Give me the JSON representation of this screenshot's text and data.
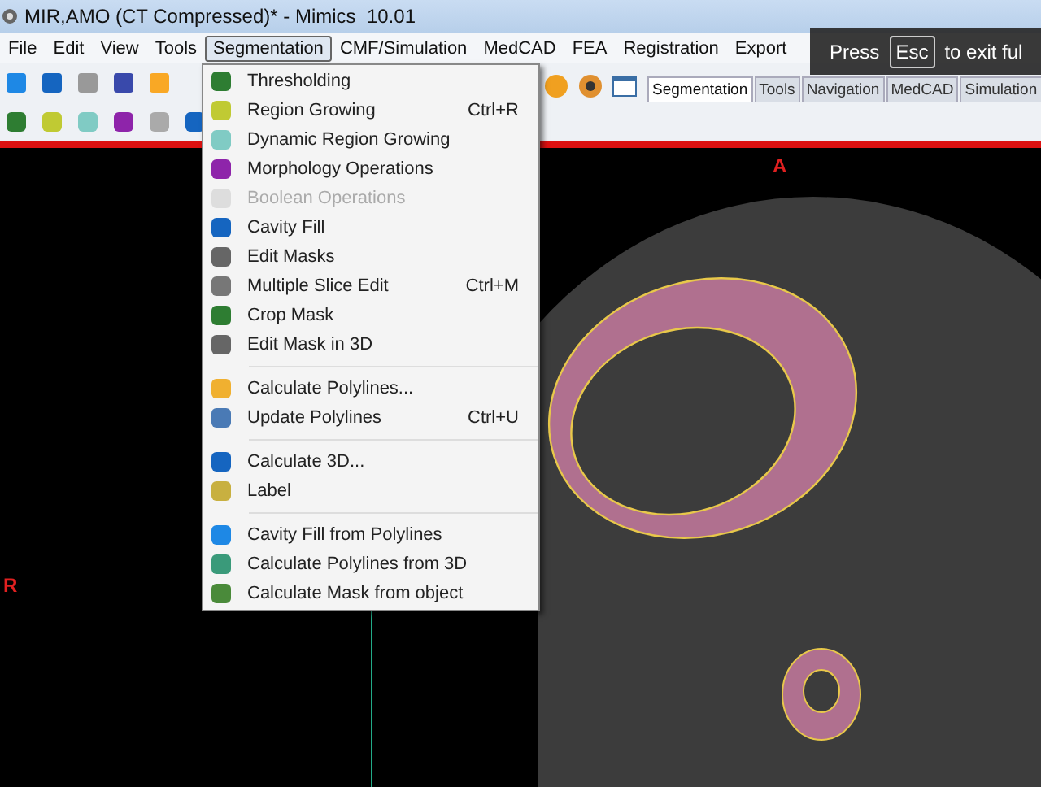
{
  "window": {
    "title": "MIR,AMO (CT Compressed)* - Mimics  10.01"
  },
  "menubar": [
    {
      "label": "File",
      "selected": false
    },
    {
      "label": "Edit",
      "selected": false
    },
    {
      "label": "View",
      "selected": false
    },
    {
      "label": "Tools",
      "selected": false
    },
    {
      "label": "Segmentation",
      "selected": true
    },
    {
      "label": "CMF/Simulation",
      "selected": false
    },
    {
      "label": "MedCAD",
      "selected": false
    },
    {
      "label": "FEA",
      "selected": false
    },
    {
      "label": "Registration",
      "selected": false
    },
    {
      "label": "Export",
      "selected": false
    }
  ],
  "tabs": [
    {
      "label": "Segmentation",
      "selected": true
    },
    {
      "label": "Tools",
      "selected": false
    },
    {
      "label": "Navigation",
      "selected": false
    },
    {
      "label": "MedCAD",
      "selected": false
    },
    {
      "label": "Simulation",
      "selected": false
    }
  ],
  "menu": {
    "groups": [
      [
        {
          "label": "Thresholding",
          "disabled": false
        },
        {
          "label": "Region Growing",
          "shortcut": "Ctrl+R",
          "disabled": false
        },
        {
          "label": "Dynamic Region Growing",
          "disabled": false
        },
        {
          "label": "Morphology Operations",
          "disabled": false
        },
        {
          "label": "Boolean Operations",
          "disabled": true
        },
        {
          "label": "Cavity Fill",
          "disabled": false
        },
        {
          "label": "Edit Masks",
          "disabled": false
        },
        {
          "label": "Multiple Slice Edit",
          "shortcut": "Ctrl+M",
          "disabled": false
        },
        {
          "label": "Crop Mask",
          "disabled": false
        },
        {
          "label": "Edit Mask in 3D",
          "disabled": false
        }
      ],
      [
        {
          "label": "Calculate Polylines...",
          "disabled": false
        },
        {
          "label": "Update Polylines",
          "shortcut": "Ctrl+U",
          "disabled": false
        }
      ],
      [
        {
          "label": "Calculate 3D...",
          "disabled": false
        },
        {
          "label": "Label",
          "disabled": false
        }
      ],
      [
        {
          "label": "Cavity Fill from Polylines",
          "disabled": false
        },
        {
          "label": "Calculate Polylines from 3D",
          "disabled": false
        },
        {
          "label": "Calculate Mask from object",
          "disabled": false
        }
      ]
    ]
  },
  "viewport": {
    "top_label": "A",
    "left_label": "R"
  },
  "overlay": {
    "before": "Press",
    "key": "Esc",
    "after": "to exit ful"
  }
}
